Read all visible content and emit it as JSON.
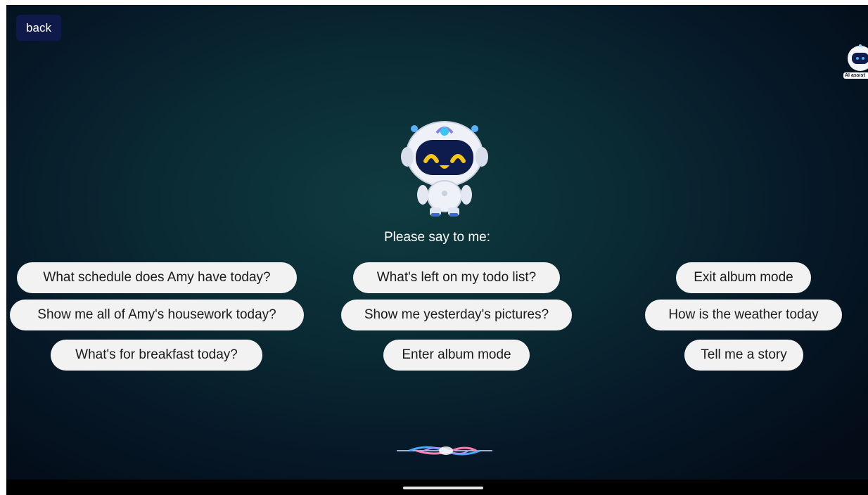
{
  "header": {
    "back_label": "back"
  },
  "assistant": {
    "badge_label": "AI assist",
    "icon": "robot-icon"
  },
  "main": {
    "prompt": "Please say to me:",
    "suggestions": {
      "left": [
        "What schedule does Amy have today?",
        "Show me all of Amy's housework today?",
        "What's for breakfast today?"
      ],
      "center": [
        "What's left on my todo list?",
        "Show me yesterday's pictures?",
        "Enter album mode"
      ],
      "right": [
        "Exit album mode",
        "How is the weather today",
        "Tell me a story"
      ]
    }
  },
  "colors": {
    "chip_bg": "#f2f2f2",
    "back_bg": "#101a4a",
    "robot_face": "#0d1b4d",
    "robot_eyes": "#f5c518",
    "wave_blue": "#4aa8ff",
    "wave_pink": "#ff7fb3"
  }
}
